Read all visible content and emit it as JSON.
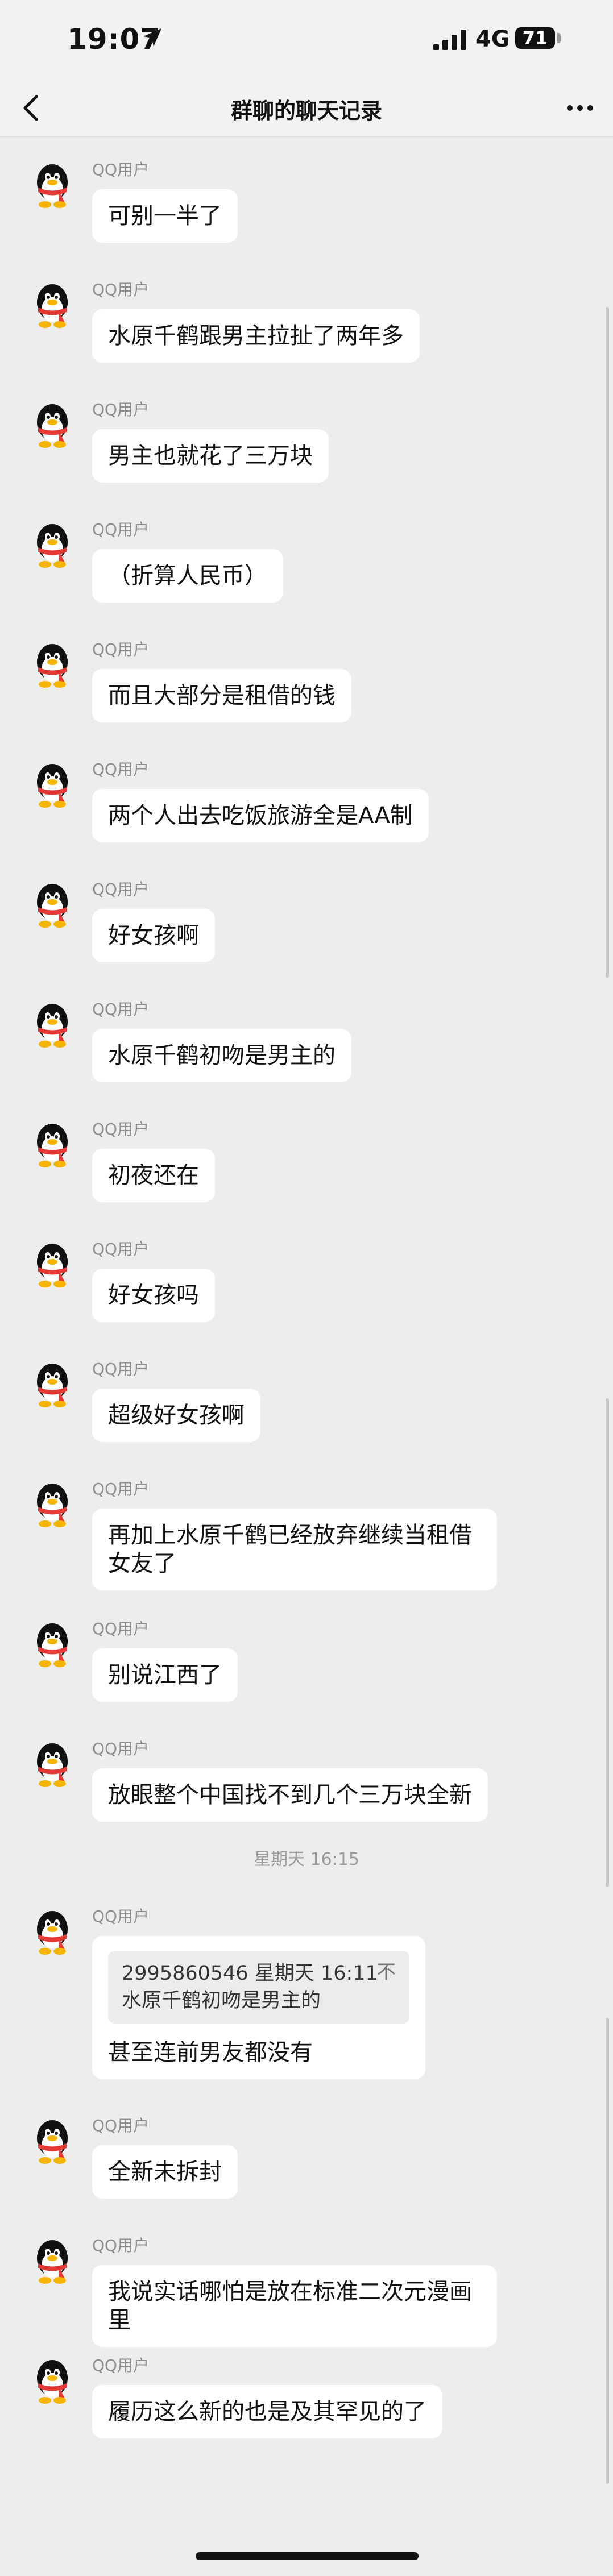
{
  "status": {
    "time": "19:07",
    "network": "4G",
    "battery": "71"
  },
  "nav": {
    "title": "群聊的聊天记录"
  },
  "messages_a": [
    {
      "sender": "QQ用户",
      "text": "可别一半了"
    },
    {
      "sender": "QQ用户",
      "text": "水原千鹤跟男主拉扯了两年多"
    },
    {
      "sender": "QQ用户",
      "text": "男主也就花了三万块"
    },
    {
      "sender": "QQ用户",
      "text": "（折算人民币）"
    },
    {
      "sender": "QQ用户",
      "text": "而且大部分是租借的钱"
    },
    {
      "sender": "QQ用户",
      "text": "两个人出去吃饭旅游全是AA制"
    },
    {
      "sender": "QQ用户",
      "text": "好女孩啊"
    },
    {
      "sender": "QQ用户",
      "text": "水原千鹤初吻是男主的"
    },
    {
      "sender": "QQ用户",
      "text": "初夜还在"
    },
    {
      "sender": "QQ用户",
      "text": "好女孩吗"
    },
    {
      "sender": "QQ用户",
      "text": "超级好女孩啊"
    },
    {
      "sender": "QQ用户",
      "text": "再加上水原千鹤已经放弃继续当租借女友了"
    },
    {
      "sender": "QQ用户",
      "text": "别说江西了"
    },
    {
      "sender": "QQ用户",
      "text": "放眼整个中国找不到几个三万块全新"
    }
  ],
  "divider": "星期天 16:15",
  "quote_message": {
    "sender": "QQ用户",
    "quote_header": "2995860546 星期天 16:11",
    "quote_text": "水原千鹤初吻是男主的",
    "quote_close": "不",
    "reply": "甚至连前男友都没有"
  },
  "messages_b": [
    {
      "sender": "QQ用户",
      "text": "全新未拆封"
    },
    {
      "sender": "QQ用户",
      "text": "我说实话哪怕是放在标准二次元漫画里"
    },
    {
      "sender": "QQ用户",
      "text": "履历这么新的也是及其罕见的了"
    }
  ],
  "icons": {
    "back": "chevron-left-icon",
    "more": "more-dots-icon",
    "location": "location-arrow-icon",
    "avatar": "qq-penguin-avatar"
  },
  "colors": {
    "background": "#ededed",
    "bubble": "#ffffff",
    "quote_box": "#ececec",
    "sender": "#8e8e8e"
  }
}
